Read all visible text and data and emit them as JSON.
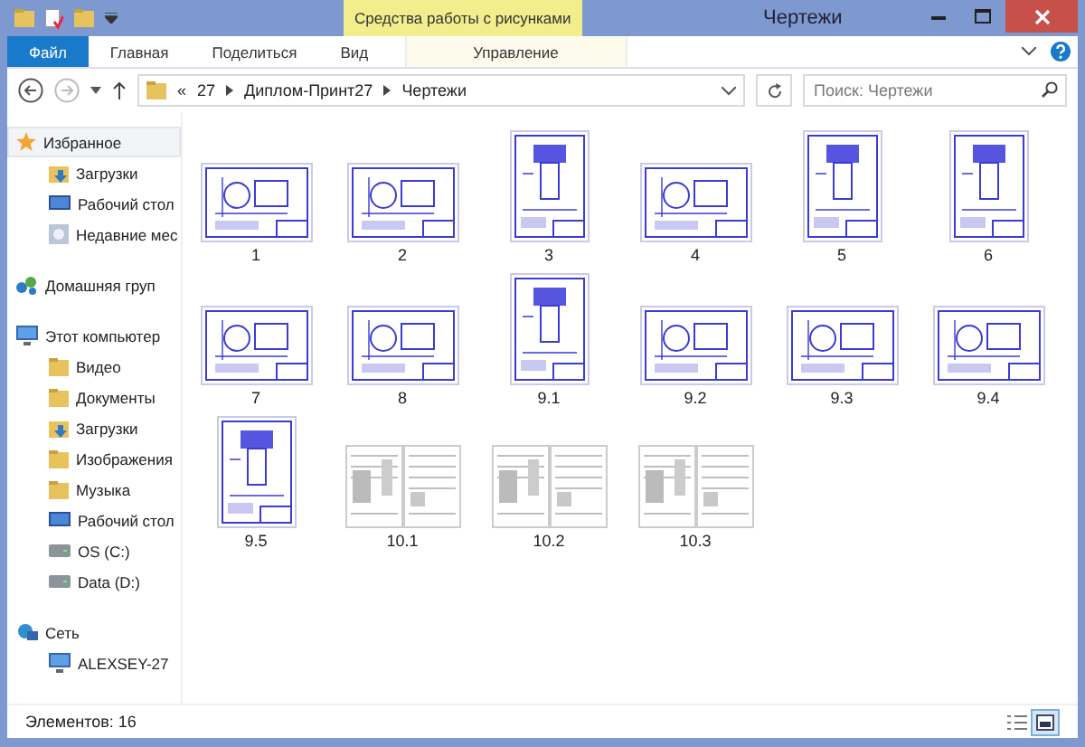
{
  "window": {
    "title": "Чертежи",
    "context_tab": "Средства работы с рисунками"
  },
  "ribbon_tabs": [
    {
      "label": "Файл",
      "kind": "file"
    },
    {
      "label": "Главная",
      "kind": "tab"
    },
    {
      "label": "Поделиться",
      "kind": "tab"
    },
    {
      "label": "Вид",
      "kind": "tab"
    },
    {
      "label": "Управление",
      "kind": "context"
    }
  ],
  "address": {
    "crumbs": [
      "«",
      "27",
      "Диплом-Принт27",
      "Чертежи"
    ]
  },
  "search": {
    "placeholder": "Поиск: Чертежи"
  },
  "sidebar": [
    {
      "label": "Избранное",
      "kind": "star",
      "selected": true,
      "children": [
        {
          "label": "Загрузки",
          "kind": "download",
          "selected": false
        },
        {
          "label": "Рабочий стол",
          "kind": "desktop",
          "selected": false
        },
        {
          "label": "Недавние мес",
          "kind": "recent",
          "selected": false
        }
      ]
    },
    {
      "label": "Домашняя груп",
      "kind": "homegroup",
      "selected": false
    },
    {
      "label": "Этот компьютер",
      "kind": "computer",
      "selected": false,
      "children": [
        {
          "label": "Видео",
          "kind": "folder",
          "selected": false
        },
        {
          "label": "Документы",
          "kind": "folder",
          "selected": false
        },
        {
          "label": "Загрузки",
          "kind": "download",
          "selected": false
        },
        {
          "label": "Изображения",
          "kind": "folder",
          "selected": false
        },
        {
          "label": "Музыка",
          "kind": "folder",
          "selected": false
        },
        {
          "label": "Рабочий стол",
          "kind": "desktop",
          "selected": false
        },
        {
          "label": "OS (C:)",
          "kind": "drive",
          "selected": false
        },
        {
          "label": "Data (D:)",
          "kind": "drive",
          "selected": false
        }
      ]
    },
    {
      "label": "Сеть",
      "kind": "network",
      "selected": false,
      "children": [
        {
          "label": "ALEXSEY-27",
          "kind": "computer",
          "selected": false
        }
      ]
    }
  ],
  "files": [
    {
      "name": "1",
      "kind": "landscape"
    },
    {
      "name": "2",
      "kind": "landscape"
    },
    {
      "name": "3",
      "kind": "portrait"
    },
    {
      "name": "4",
      "kind": "landscape"
    },
    {
      "name": "5",
      "kind": "portrait"
    },
    {
      "name": "6",
      "kind": "portrait"
    },
    {
      "name": "7",
      "kind": "landscape"
    },
    {
      "name": "8",
      "kind": "landscape"
    },
    {
      "name": "9.1",
      "kind": "portrait"
    },
    {
      "name": "9.2",
      "kind": "landscape"
    },
    {
      "name": "9.3",
      "kind": "landscape"
    },
    {
      "name": "9.4",
      "kind": "landscape"
    },
    {
      "name": "9.5",
      "kind": "portrait"
    },
    {
      "name": "10.1",
      "kind": "spread"
    },
    {
      "name": "10.2",
      "kind": "spread"
    },
    {
      "name": "10.3",
      "kind": "spread"
    }
  ],
  "status_bar": {
    "count": "Элементов: 16"
  },
  "view_buttons": [
    {
      "kind": "details",
      "selected": false
    },
    {
      "kind": "thumbnails",
      "selected": true
    }
  ]
}
